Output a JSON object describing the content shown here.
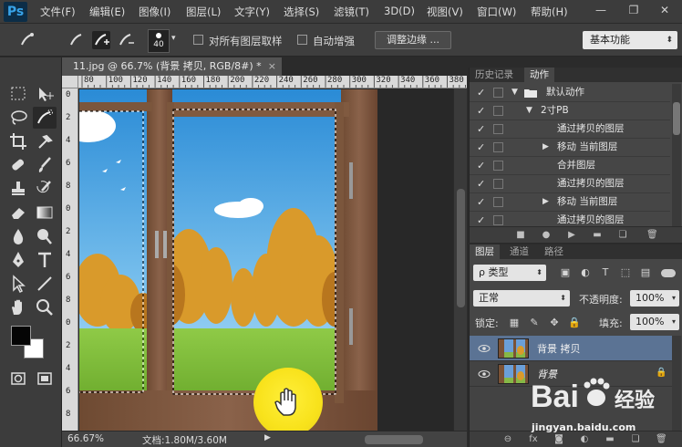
{
  "app": {
    "logo": "Ps"
  },
  "menu": [
    "文件(F)",
    "编辑(E)",
    "图像(I)",
    "图层(L)",
    "文字(Y)",
    "选择(S)",
    "滤镜(T)",
    "3D(D)",
    "视图(V)",
    "窗口(W)",
    "帮助(H)"
  ],
  "window_controls": [
    "—",
    "❐",
    "✕"
  ],
  "options": {
    "brush_size": "40",
    "sample_all_layers": "对所有图层取样",
    "auto_enhance": "自动增强",
    "refine_edge": "调整边缘 ...",
    "workspace": "基本功能"
  },
  "document": {
    "tab_title": "11.jpg @ 66.7% (背景 拷贝, RGB/8#) *",
    "close": "×",
    "ruler_h": [
      "80",
      "100",
      "120",
      "140",
      "160",
      "180",
      "200",
      "220",
      "240",
      "260",
      "280",
      "300",
      "320",
      "340",
      "360",
      "380",
      "400"
    ],
    "ruler_v": [
      "0",
      "2",
      "4",
      "6",
      "8",
      "0",
      "2",
      "4",
      "6",
      "8",
      "0",
      "2",
      "4",
      "6",
      "8"
    ],
    "zoom": "66.67%",
    "doc_info": "文档:1.80M/3.60M"
  },
  "actions_panel": {
    "tabs": [
      "历史记录",
      "动作"
    ],
    "rows": [
      {
        "label": "默认动作",
        "checked": "✓",
        "expand": "▼",
        "folder": "folder-icon"
      },
      {
        "label": "2寸PB",
        "checked": "✓",
        "expand": "▼"
      },
      {
        "label": "通过拷贝的图层",
        "checked": "✓",
        "expand": ""
      },
      {
        "label": "移动 当前图层",
        "checked": "✓",
        "expand": "▶"
      },
      {
        "label": "合并图层",
        "checked": "✓",
        "expand": ""
      },
      {
        "label": "通过拷贝的图层",
        "checked": "✓",
        "expand": ""
      },
      {
        "label": "移动 当前图层",
        "checked": "✓",
        "expand": "▶"
      },
      {
        "label": "通过拷贝的图层",
        "checked": "✓",
        "expand": ""
      }
    ]
  },
  "layers_panel": {
    "tabs": [
      "图层",
      "通道",
      "路径"
    ],
    "filter_kind": "ρ 类型",
    "blend_mode": "正常",
    "opacity_label": "不透明度:",
    "opacity": "100%",
    "lock_label": "锁定:",
    "fill_label": "填充:",
    "fill": "100%",
    "layers": [
      {
        "name": "背景 拷贝",
        "selected": true
      },
      {
        "name": "背景",
        "selected": false
      }
    ]
  },
  "watermark": {
    "text": "jingyan.baidu.com",
    "logo": "Bai 经验"
  }
}
